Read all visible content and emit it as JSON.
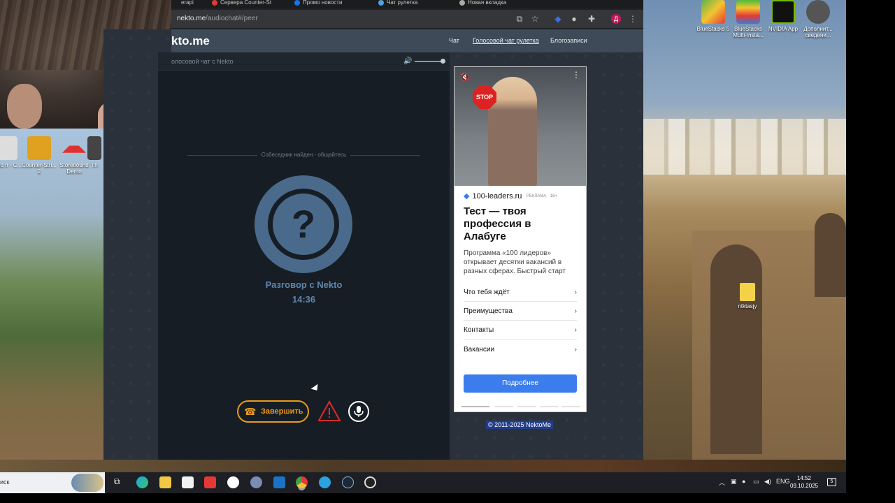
{
  "browser": {
    "tabs": [
      {
        "label": "erapi",
        "color": "#888"
      },
      {
        "label": "Сервера Counter-St",
        "color": "#e53935"
      },
      {
        "label": "Промо новости",
        "color": "#1a73e8"
      },
      {
        "label": "Чат рулетка",
        "color": "#4fa3e3"
      },
      {
        "label": "Новая вкладка",
        "color": "#aaa"
      }
    ],
    "url_domain": "nekto.me",
    "url_path": "/audiochat#/peer",
    "avatar_letter": "Д"
  },
  "site": {
    "logo": "kto.me",
    "nav": [
      "Чат",
      "Голосовой чат рулетка",
      "Блогозаписи"
    ],
    "chat_title": "олосовой чат с Nekto",
    "found_text": "Собеседник найден - общайтесь",
    "partner_name": "Разговор с Nekto",
    "timer": "14:36",
    "end_label": "Завершить",
    "copyright": "© 2011-2025 NektoMe"
  },
  "ad": {
    "stop_sign": "STOP",
    "domain": "100-leaders.ru",
    "label": "РЕКЛАМА · 16+",
    "title": "Тест — твоя профессия в Алабуге",
    "desc": "Программа «100 лидеров» открывает десятки вакансий в разных сферах. Быстрый старт",
    "links": [
      "Что тебя ждёт",
      "Преимущества",
      "Контакты",
      "Вакансии"
    ],
    "cta": "Подробнее"
  },
  "desktop_icons_left": [
    {
      "label": "e and n - C...",
      "color": "#ddd"
    },
    {
      "label": "Counter-Stri... 2",
      "color": "#e0a020"
    },
    {
      "label": "Storebound Demo",
      "color": "#e03030"
    },
    {
      "label": "Th",
      "color": "#444"
    }
  ],
  "desktop_icons_right": [
    {
      "label": "BlueStacks 5",
      "color": "#5ab54a"
    },
    {
      "label": "BlueStacks Multi-Insta...",
      "color": "#4dbb3a"
    },
    {
      "label": "NVIDIA App",
      "color": "#76b900"
    },
    {
      "label": "Дополнит... сведени...",
      "color": "#555"
    }
  ],
  "folder_icon": {
    "label": "ntktasjy",
    "color": "#f3d24a"
  },
  "taskbar": {
    "search": "иск",
    "language": "ENG",
    "time": "14:52",
    "date": "09.10.2025",
    "notifications": "5"
  }
}
